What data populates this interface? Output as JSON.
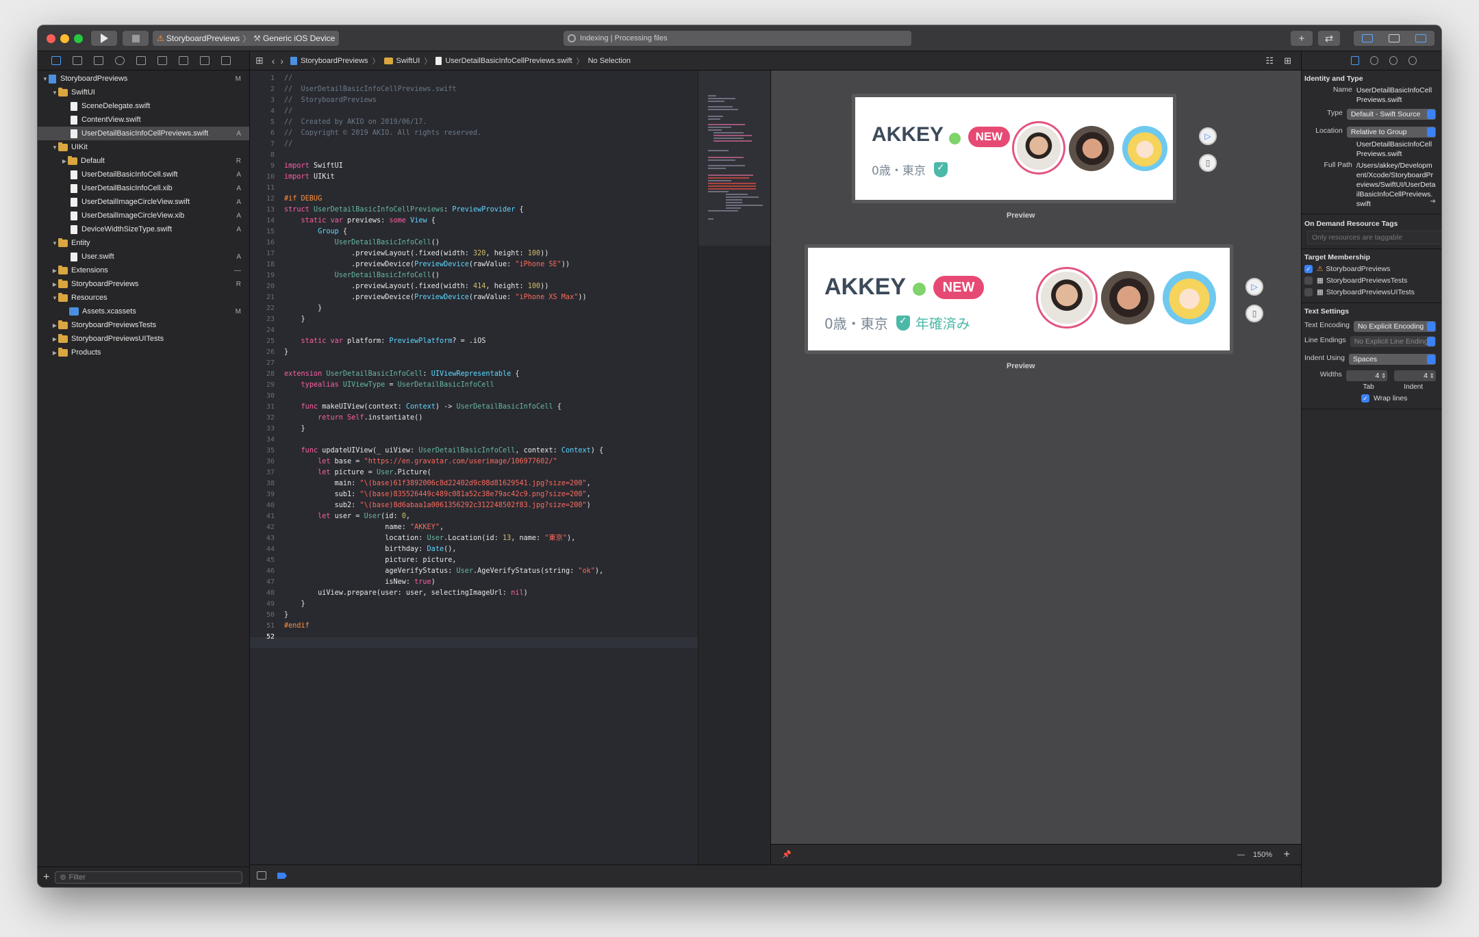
{
  "toolbar": {
    "scheme_project": "StoryboardPreviews",
    "scheme_device": "Generic iOS Device",
    "activity": "Indexing | Processing files",
    "add_label": "+",
    "swap_label": "⇄"
  },
  "navigator": {
    "filter_placeholder": "Filter",
    "items": [
      {
        "label": "StoryboardPreviews",
        "badge": "M"
      },
      {
        "label": "SwiftUI",
        "badge": ""
      },
      {
        "label": "SceneDelegate.swift",
        "badge": ""
      },
      {
        "label": "ContentView.swift",
        "badge": ""
      },
      {
        "label": "UserDetailBasicInfoCellPreviews.swift",
        "badge": "A"
      },
      {
        "label": "UIKit",
        "badge": ""
      },
      {
        "label": "Default",
        "badge": "R"
      },
      {
        "label": "UserDetailBasicInfoCell.swift",
        "badge": "A"
      },
      {
        "label": "UserDetailBasicInfoCell.xib",
        "badge": "A"
      },
      {
        "label": "UserDetailImageCircleView.swift",
        "badge": "A"
      },
      {
        "label": "UserDetailImageCircleView.xib",
        "badge": "A"
      },
      {
        "label": "DeviceWidthSizeType.swift",
        "badge": "A"
      },
      {
        "label": "Entity",
        "badge": ""
      },
      {
        "label": "User.swift",
        "badge": "A"
      },
      {
        "label": "Extensions",
        "badge": "—"
      },
      {
        "label": "StoryboardPreviews",
        "badge": "R"
      },
      {
        "label": "Resources",
        "badge": ""
      },
      {
        "label": "Assets.xcassets",
        "badge": "M"
      },
      {
        "label": "StoryboardPreviewsTests",
        "badge": ""
      },
      {
        "label": "StoryboardPreviewsUITests",
        "badge": ""
      },
      {
        "label": "Products",
        "badge": ""
      }
    ]
  },
  "jumpbar": {
    "project": "StoryboardPreviews",
    "group": "SwiftUI",
    "file": "UserDetailBasicInfoCellPreviews.swift",
    "selection": "No Selection"
  },
  "editor": {
    "line_numbers": [
      "1",
      "2",
      "3",
      "4",
      "5",
      "6",
      "7",
      "8",
      "9",
      "10",
      "11",
      "12",
      "13",
      "14",
      "15",
      "16",
      "17",
      "18",
      "19",
      "20",
      "21",
      "22",
      "23",
      "24",
      "25",
      "26",
      "27",
      "28",
      "29",
      "30",
      "31",
      "32",
      "33",
      "34",
      "35",
      "36",
      "37",
      "38",
      "39",
      "40",
      "41",
      "42",
      "43",
      "44",
      "45",
      "46",
      "47",
      "48",
      "49",
      "50",
      "51",
      "52"
    ],
    "lines": [
      "//",
      "//  UserDetailBasicInfoCellPreviews.swift",
      "//  StoryboardPreviews",
      "//",
      "//  Created by AKIO on 2019/06/17.",
      "//  Copyright © 2019 AKIO. All rights reserved.",
      "//",
      "",
      "import SwiftUI",
      "import UIKit",
      "",
      "#if DEBUG",
      "struct UserDetailBasicInfoCellPreviews: PreviewProvider {",
      "    static var previews: some View {",
      "        Group {",
      "            UserDetailBasicInfoCell()",
      "                .previewLayout(.fixed(width: 320, height: 100))",
      "                .previewDevice(PreviewDevice(rawValue: \"iPhone SE\"))",
      "            UserDetailBasicInfoCell()",
      "                .previewLayout(.fixed(width: 414, height: 100))",
      "                .previewDevice(PreviewDevice(rawValue: \"iPhone XS Max\"))",
      "        }",
      "    }",
      "",
      "    static var platform: PreviewPlatform? = .iOS",
      "}",
      "",
      "extension UserDetailBasicInfoCell: UIViewRepresentable {",
      "    typealias UIViewType = UserDetailBasicInfoCell",
      "",
      "    func makeUIView(context: Context) -> UserDetailBasicInfoCell {",
      "        return Self.instantiate()",
      "    }",
      "",
      "    func updateUIView(_ uiView: UserDetailBasicInfoCell, context: Context) {",
      "        let base = \"https://en.gravatar.com/userimage/106977602/\"",
      "        let picture = User.Picture(",
      "            main: \"\\(base)61f3892006c8d22402d9c08d81629541.jpg?size=200\",",
      "            sub1: \"\\(base)835526449c489c081a52c38e79ac42c9.png?size=200\",",
      "            sub2: \"\\(base)8d6abaa1a0061356292c312248502f83.jpg?size=200\")",
      "        let user = User(id: 0,",
      "                        name: \"AKKEY\",",
      "                        location: User.Location(id: 13, name: \"東京\"),",
      "                        birthday: Date(),",
      "                        picture: picture,",
      "                        ageVerifyStatus: User.AgeVerifyStatus(string: \"ok\"),",
      "                        isNew: true)",
      "        uiView.prepare(user: user, selectingImageUrl: nil)",
      "    }",
      "}",
      "#endif",
      ""
    ]
  },
  "canvas": {
    "previews": [
      {
        "name": "AKKEY",
        "badge": "NEW",
        "sub": "0歳・東京",
        "verified": "",
        "label": "Preview"
      },
      {
        "name": "AKKEY",
        "badge": "NEW",
        "sub": "0歳・東京",
        "verified": "年確済み",
        "label": "Preview"
      }
    ],
    "zoom": "150%",
    "zoom_minus": "—",
    "zoom_plus": "+"
  },
  "inspector": {
    "identity_title": "Identity and Type",
    "name_label": "Name",
    "name_value": "UserDetailBasicInfoCellPreviews.swift",
    "type_label": "Type",
    "type_value": "Default - Swift Source",
    "location_label": "Location",
    "location_value": "Relative to Group",
    "location_file": "UserDetailBasicInfoCellPreviews.swift",
    "fullpath_label": "Full Path",
    "fullpath_value": "/Users/akkey/Development/Xcode/StoryboardPreviews/SwiftUI/UserDetailBasicInfoCellPreviews.swift",
    "odr_title": "On Demand Resource Tags",
    "odr_placeholder": "Only resources are taggable",
    "target_title": "Target Membership",
    "targets": [
      {
        "label": "StoryboardPreviews",
        "checked": true
      },
      {
        "label": "StoryboardPreviewsTests",
        "checked": false
      },
      {
        "label": "StoryboardPreviewsUITests",
        "checked": false
      }
    ],
    "text_title": "Text Settings",
    "encoding_label": "Text Encoding",
    "encoding_value": "No Explicit Encoding",
    "line_endings_label": "Line Endings",
    "line_endings_value": "No Explicit Line Endings",
    "indent_label": "Indent Using",
    "indent_value": "Spaces",
    "widths_label": "Widths",
    "tab_value": "4",
    "indent_width_value": "4",
    "tab_caption": "Tab",
    "indent_caption": "Indent",
    "wrap_label": "Wrap lines",
    "check": "✓"
  }
}
